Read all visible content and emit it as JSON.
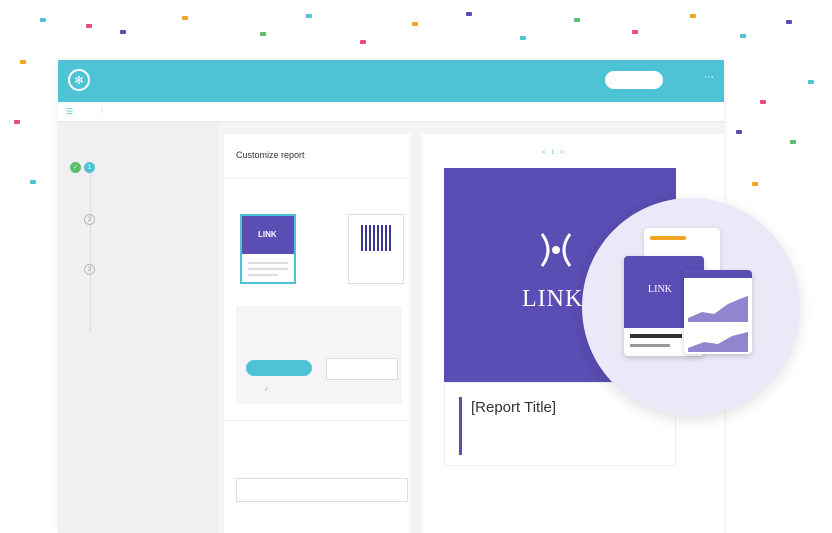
{
  "app": {
    "brand": "",
    "nav": [
      "",
      "",
      "",
      "",
      "",
      "",
      ""
    ],
    "cta": "",
    "breadcrumb": [
      "",
      ""
    ]
  },
  "steps": {
    "title": "",
    "items": [
      {
        "label": "",
        "state": "done"
      },
      {
        "label": "",
        "state": "pending"
      },
      {
        "label": "",
        "state": "pending"
      }
    ]
  },
  "editor": {
    "title": "Customize report",
    "template_section": "",
    "template_options": [
      {
        "caption": "",
        "cover_text": "LINK",
        "selected": true
      },
      {
        "caption": "",
        "selected": false
      }
    ],
    "options_text": "",
    "option_labels": [
      "",
      ""
    ],
    "primary_button": "",
    "input_value": "",
    "check_label": "",
    "cover_section": "",
    "field_label": ""
  },
  "preview": {
    "pager": "< 1 >",
    "cover_brand": "LINK",
    "cover_sub": "",
    "report_title": "[Report Title]",
    "report_subtitle": "",
    "report_date": "",
    "covers_heading": "",
    "covers_text": ""
  },
  "bubble": {
    "cover_brand": "LINK"
  },
  "colors": {
    "topbar": "#4fc3d6",
    "cover": "#5a4db3",
    "success": "#5bbf6a",
    "bubble": "#ece8f7"
  }
}
